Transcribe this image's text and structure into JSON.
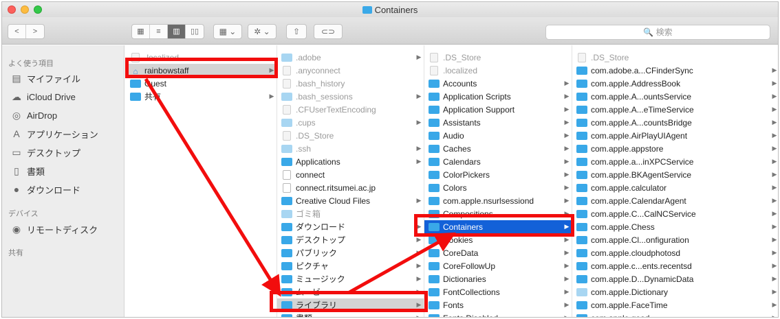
{
  "window": {
    "title": "Containers"
  },
  "toolbar": {
    "back_glyph": "<",
    "forward_glyph": ">",
    "view_icons": [
      "icon-view-icon",
      "list-view-icon",
      "column-view-icon",
      "cover-flow-view-icon"
    ],
    "group_glyph": "▦ ⌄",
    "action_glyph": "✲ ⌄",
    "share_glyph": "⇧",
    "tag_glyph": "⊂⊃",
    "search_placeholder": "🔍 検索"
  },
  "sidebar": {
    "favorites_header": "よく使う項目",
    "favorites": [
      {
        "label": "マイファイル",
        "icon": "all-files-icon",
        "glyph": "▤"
      },
      {
        "label": "iCloud Drive",
        "icon": "cloud-icon",
        "glyph": "☁"
      },
      {
        "label": "AirDrop",
        "icon": "airdrop-icon",
        "glyph": "◎"
      },
      {
        "label": "アプリケーション",
        "icon": "applications-icon",
        "glyph": "A"
      },
      {
        "label": "デスクトップ",
        "icon": "desktop-icon",
        "glyph": "▭"
      },
      {
        "label": "書類",
        "icon": "documents-icon",
        "glyph": "▯"
      },
      {
        "label": "ダウンロード",
        "icon": "downloads-icon",
        "glyph": "●"
      }
    ],
    "devices_header": "デバイス",
    "devices": [
      {
        "label": "リモートディスク",
        "icon": "remote-disc-icon",
        "glyph": "◉"
      }
    ],
    "shared_header": "共有"
  },
  "columns": [
    {
      "rows": [
        {
          "label": ".localized",
          "type": "grey-file",
          "chevron": false,
          "style": "grey"
        },
        {
          "label": "rainbowstaff",
          "type": "home",
          "chevron": true,
          "style": "sel-grey"
        },
        {
          "label": "Guest",
          "type": "folder",
          "chevron": false,
          "style": ""
        },
        {
          "label": "共有",
          "type": "folder",
          "chevron": true,
          "style": ""
        }
      ]
    },
    {
      "rows": [
        {
          "label": ".adobe",
          "type": "ghost",
          "chevron": true,
          "style": "grey"
        },
        {
          "label": ".anyconnect",
          "type": "grey-file",
          "chevron": false,
          "style": "grey"
        },
        {
          "label": ".bash_history",
          "type": "grey-file",
          "chevron": false,
          "style": "grey"
        },
        {
          "label": ".bash_sessions",
          "type": "ghost",
          "chevron": true,
          "style": "grey"
        },
        {
          "label": ".CFUserTextEncoding",
          "type": "grey-file",
          "chevron": false,
          "style": "grey"
        },
        {
          "label": ".cups",
          "type": "ghost",
          "chevron": true,
          "style": "grey"
        },
        {
          "label": ".DS_Store",
          "type": "grey-file",
          "chevron": false,
          "style": "grey"
        },
        {
          "label": ".ssh",
          "type": "ghost",
          "chevron": true,
          "style": "grey"
        },
        {
          "label": "Applications",
          "type": "folder",
          "chevron": true,
          "style": ""
        },
        {
          "label": "connect",
          "type": "file",
          "chevron": false,
          "style": ""
        },
        {
          "label": "connect.ritsumei.ac.jp",
          "type": "file",
          "chevron": false,
          "style": ""
        },
        {
          "label": "Creative Cloud Files",
          "type": "folder",
          "chevron": true,
          "style": ""
        },
        {
          "label": "ゴミ箱",
          "type": "ghost",
          "chevron": false,
          "style": "grey"
        },
        {
          "label": "ダウンロード",
          "type": "folder",
          "chevron": true,
          "style": ""
        },
        {
          "label": "デスクトップ",
          "type": "folder",
          "chevron": true,
          "style": ""
        },
        {
          "label": "パブリック",
          "type": "folder",
          "chevron": true,
          "style": ""
        },
        {
          "label": "ピクチャ",
          "type": "folder",
          "chevron": true,
          "style": ""
        },
        {
          "label": "ミュージック",
          "type": "folder",
          "chevron": true,
          "style": ""
        },
        {
          "label": "ムービー",
          "type": "folder",
          "chevron": true,
          "style": ""
        },
        {
          "label": "ライブラリ",
          "type": "folder",
          "chevron": true,
          "style": "sel-grey"
        },
        {
          "label": "書類",
          "type": "folder",
          "chevron": true,
          "style": ""
        }
      ]
    },
    {
      "rows": [
        {
          "label": ".DS_Store",
          "type": "grey-file",
          "chevron": false,
          "style": "grey"
        },
        {
          "label": ".localized",
          "type": "grey-file",
          "chevron": false,
          "style": "grey"
        },
        {
          "label": "Accounts",
          "type": "folder",
          "chevron": true,
          "style": ""
        },
        {
          "label": "Application Scripts",
          "type": "folder",
          "chevron": true,
          "style": ""
        },
        {
          "label": "Application Support",
          "type": "folder",
          "chevron": true,
          "style": ""
        },
        {
          "label": "Assistants",
          "type": "folder",
          "chevron": true,
          "style": ""
        },
        {
          "label": "Audio",
          "type": "folder",
          "chevron": true,
          "style": ""
        },
        {
          "label": "Caches",
          "type": "folder",
          "chevron": true,
          "style": ""
        },
        {
          "label": "Calendars",
          "type": "folder",
          "chevron": true,
          "style": ""
        },
        {
          "label": "ColorPickers",
          "type": "folder",
          "chevron": true,
          "style": ""
        },
        {
          "label": "Colors",
          "type": "folder",
          "chevron": true,
          "style": ""
        },
        {
          "label": "com.apple.nsurlsessiond",
          "type": "folder",
          "chevron": true,
          "style": ""
        },
        {
          "label": "Compositions",
          "type": "folder",
          "chevron": true,
          "style": ""
        },
        {
          "label": "Containers",
          "type": "folder",
          "chevron": true,
          "style": "sel-blue"
        },
        {
          "label": "Cookies",
          "type": "folder",
          "chevron": true,
          "style": ""
        },
        {
          "label": "CoreData",
          "type": "folder",
          "chevron": true,
          "style": ""
        },
        {
          "label": "CoreFollowUp",
          "type": "folder",
          "chevron": true,
          "style": ""
        },
        {
          "label": "Dictionaries",
          "type": "folder",
          "chevron": true,
          "style": ""
        },
        {
          "label": "FontCollections",
          "type": "folder",
          "chevron": true,
          "style": ""
        },
        {
          "label": "Fonts",
          "type": "folder",
          "chevron": true,
          "style": ""
        },
        {
          "label": "Fonts Disabled",
          "type": "folder",
          "chevron": true,
          "style": ""
        }
      ]
    },
    {
      "rows": [
        {
          "label": ".DS_Store",
          "type": "grey-file",
          "chevron": false,
          "style": "grey"
        },
        {
          "label": "com.adobe.a...CFinderSync",
          "type": "folder",
          "chevron": true,
          "style": ""
        },
        {
          "label": "com.apple.AddressBook",
          "type": "folder",
          "chevron": true,
          "style": ""
        },
        {
          "label": "com.apple.A...ountsService",
          "type": "folder",
          "chevron": true,
          "style": ""
        },
        {
          "label": "com.apple.A...eTimeService",
          "type": "folder",
          "chevron": true,
          "style": ""
        },
        {
          "label": "com.apple.A...countsBridge",
          "type": "folder",
          "chevron": true,
          "style": ""
        },
        {
          "label": "com.apple.AirPlayUIAgent",
          "type": "folder",
          "chevron": true,
          "style": ""
        },
        {
          "label": "com.apple.appstore",
          "type": "folder",
          "chevron": true,
          "style": ""
        },
        {
          "label": "com.apple.a...inXPCService",
          "type": "folder",
          "chevron": true,
          "style": ""
        },
        {
          "label": "com.apple.BKAgentService",
          "type": "folder",
          "chevron": true,
          "style": ""
        },
        {
          "label": "com.apple.calculator",
          "type": "folder",
          "chevron": true,
          "style": ""
        },
        {
          "label": "com.apple.CalendarAgent",
          "type": "folder",
          "chevron": true,
          "style": ""
        },
        {
          "label": "com.apple.C...CalNCService",
          "type": "folder",
          "chevron": true,
          "style": ""
        },
        {
          "label": "com.apple.Chess",
          "type": "folder",
          "chevron": true,
          "style": ""
        },
        {
          "label": "com.apple.Cl...onfiguration",
          "type": "folder",
          "chevron": true,
          "style": ""
        },
        {
          "label": "com.apple.cloudphotosd",
          "type": "folder",
          "chevron": true,
          "style": ""
        },
        {
          "label": "com.apple.c...ents.recentsd",
          "type": "folder",
          "chevron": true,
          "style": ""
        },
        {
          "label": "com.apple.D...DynamicData",
          "type": "folder",
          "chevron": true,
          "style": ""
        },
        {
          "label": "com.apple.Dictionary",
          "type": "ghost",
          "chevron": true,
          "style": ""
        },
        {
          "label": "com.apple.FaceTime",
          "type": "folder",
          "chevron": true,
          "style": ""
        },
        {
          "label": "com.apple.geod",
          "type": "folder",
          "chevron": true,
          "style": ""
        }
      ]
    }
  ],
  "annotation_color": "#f20d0d",
  "selection_color": "#1361d8"
}
